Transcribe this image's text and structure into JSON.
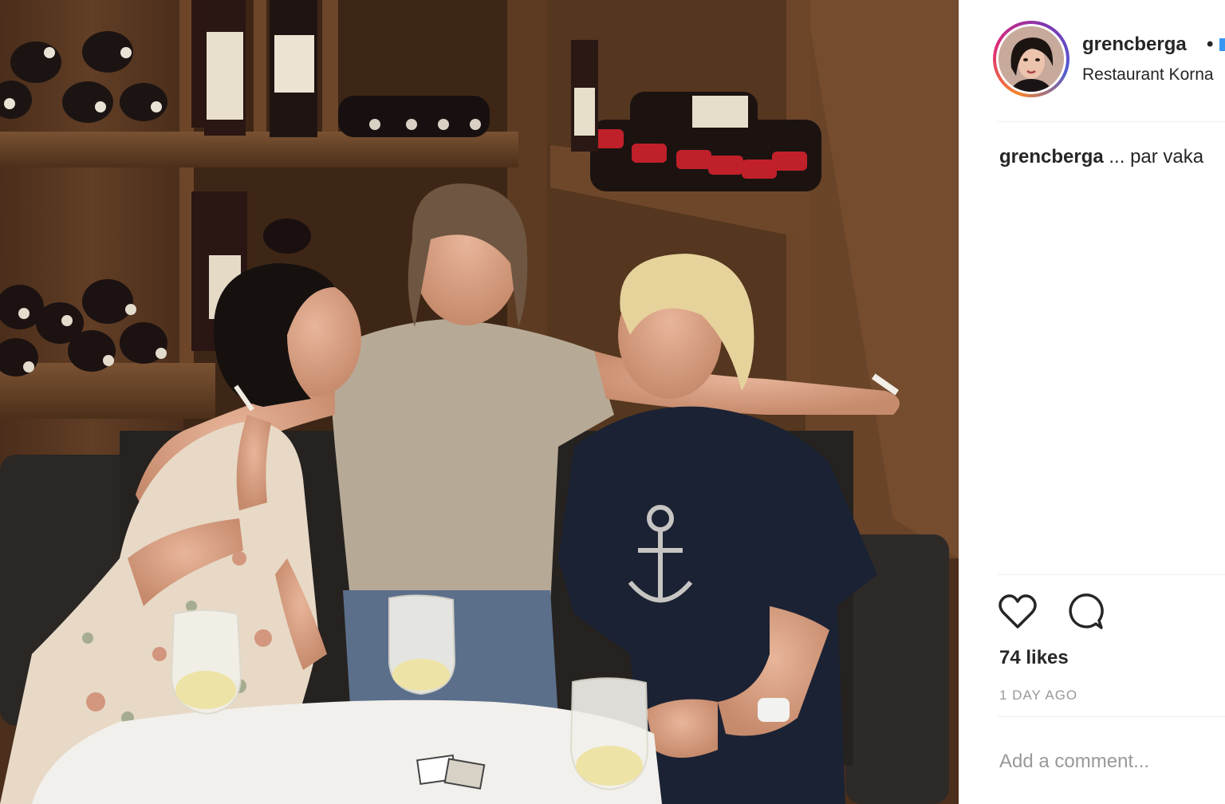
{
  "post": {
    "username": "grencberga",
    "separator": "•",
    "location": "Restaurant Korna",
    "caption_user": "grencberga",
    "caption_text": "... par vaka",
    "likes": "74 likes",
    "timestamp": "1 DAY AGO",
    "comment_placeholder": "Add a comment..."
  },
  "icons": {
    "like": "heart-icon",
    "comment": "comment-bubble-icon"
  },
  "colors": {
    "text": "#262626",
    "muted": "#999999",
    "divider": "#efefef",
    "story_ring": "#dd2a7b",
    "follow_blue": "#3897f0"
  }
}
